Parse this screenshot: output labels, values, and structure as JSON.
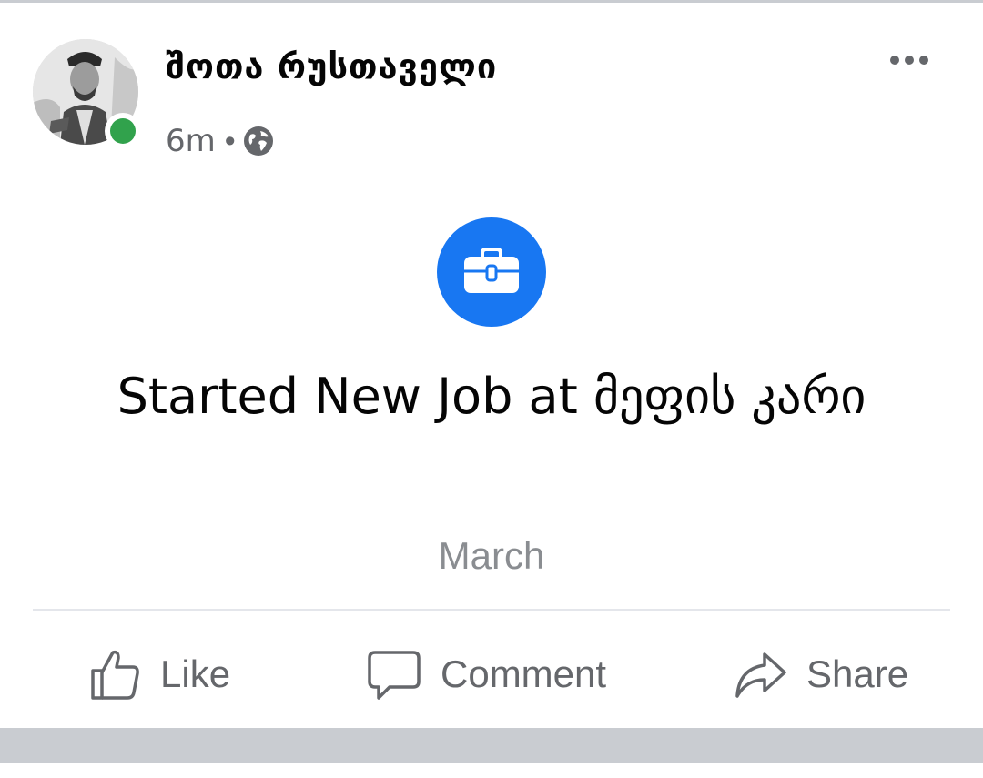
{
  "post": {
    "author_name": "შოთა რუსთაველი",
    "timestamp": "6m",
    "separator": "•",
    "audience_icon": "globe-icon",
    "more_icon": "more-dots-icon"
  },
  "life_event": {
    "icon": "briefcase-icon",
    "title": "Started New Job at მეფის კარი",
    "date": "March"
  },
  "actions": {
    "like": "Like",
    "comment": "Comment",
    "share": "Share"
  },
  "colors": {
    "accent": "#1877f2",
    "online": "#31a24c",
    "secondary_text": "#65676b",
    "date_text": "#8a8d91",
    "feed_background": "#c9ccd1"
  }
}
